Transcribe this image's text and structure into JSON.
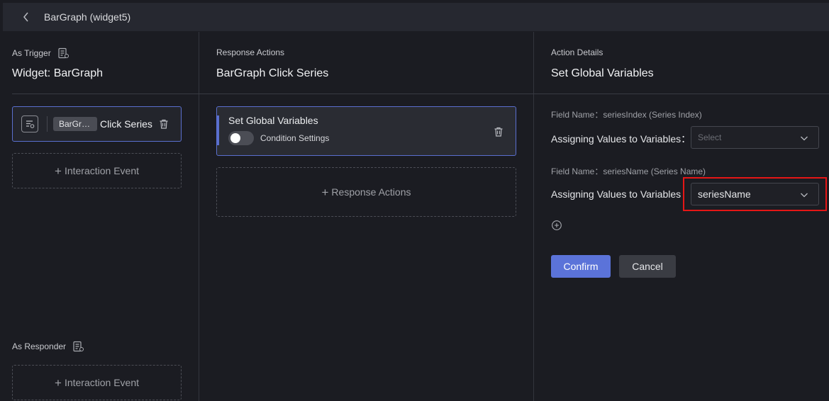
{
  "header": {
    "title": "BarGraph (widget5)"
  },
  "trigger": {
    "section_label": "As Trigger",
    "widget_title": "Widget: BarGraph",
    "card": {
      "tag": "BarGraph",
      "event": "Click Series"
    },
    "add_event_label": "Interaction Event"
  },
  "responder": {
    "section_label": "As Responder",
    "add_event_label": "Interaction Event"
  },
  "response": {
    "section_label": "Response Actions",
    "title": "BarGraph Click Series",
    "action_card": {
      "title": "Set Global Variables",
      "condition_label": "Condition Settings"
    },
    "add_action_label": "Response Actions"
  },
  "details": {
    "section_label": "Action Details",
    "title": "Set Global Variables",
    "fields": [
      {
        "field_name": "Field Name：seriesIndex (Series Index)",
        "assign_label": "Assigning Values to Variables：",
        "placeholder": "Select",
        "value": ""
      },
      {
        "field_name": "Field Name：seriesName (Series Name)",
        "assign_label": "Assigning Values to Variables",
        "placeholder": "",
        "value": "seriesName"
      }
    ],
    "confirm_label": "Confirm",
    "cancel_label": "Cancel"
  }
}
